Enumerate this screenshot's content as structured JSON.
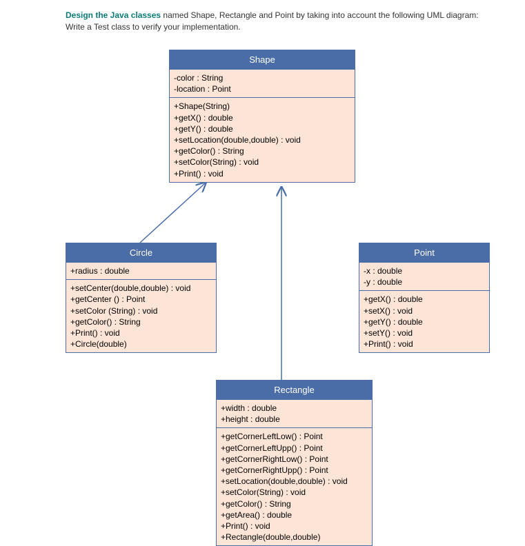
{
  "prompt": {
    "bold": "Design the Java classes",
    "rest": " named Shape, Rectangle and Point by taking into account the following UML diagram: Write a Test class to verify your implementation."
  },
  "diagram": {
    "shape": {
      "title": "Shape",
      "fields": "-color : String\n-location : Point",
      "methods": "+Shape(String)\n+getX() : double\n+getY() : double\n+setLocation(double,double) : void\n+getColor() : String\n+setColor(String) : void\n+Print() : void"
    },
    "circle": {
      "title": "Circle",
      "fields": "+radius : double",
      "methods": "+setCenter(double,double) : void\n+getCenter () : Point\n+setColor (String) : void\n+getColor() : String\n+Print() : void\n+Circle(double)"
    },
    "point": {
      "title": "Point",
      "fields": "-x : double\n-y : double",
      "methods": "+getX() : double\n+setX() : void\n+getY() : double\n+setY() : void\n+Print() : void"
    },
    "rectangle": {
      "title": "Rectangle",
      "fields": "+width : double\n+height : double",
      "methods": "+getCornerLeftLow() : Point\n+getCornerLeftUpp() : Point\n+getCornerRightLow() : Point\n+getCornerRightUpp() : Point\n+setLocation(double,double) : void\n+setColor(String) : void\n+getColor() : String\n+getArea() : double\n+Print() : void\n+Rectangle(double,double)"
    }
  }
}
